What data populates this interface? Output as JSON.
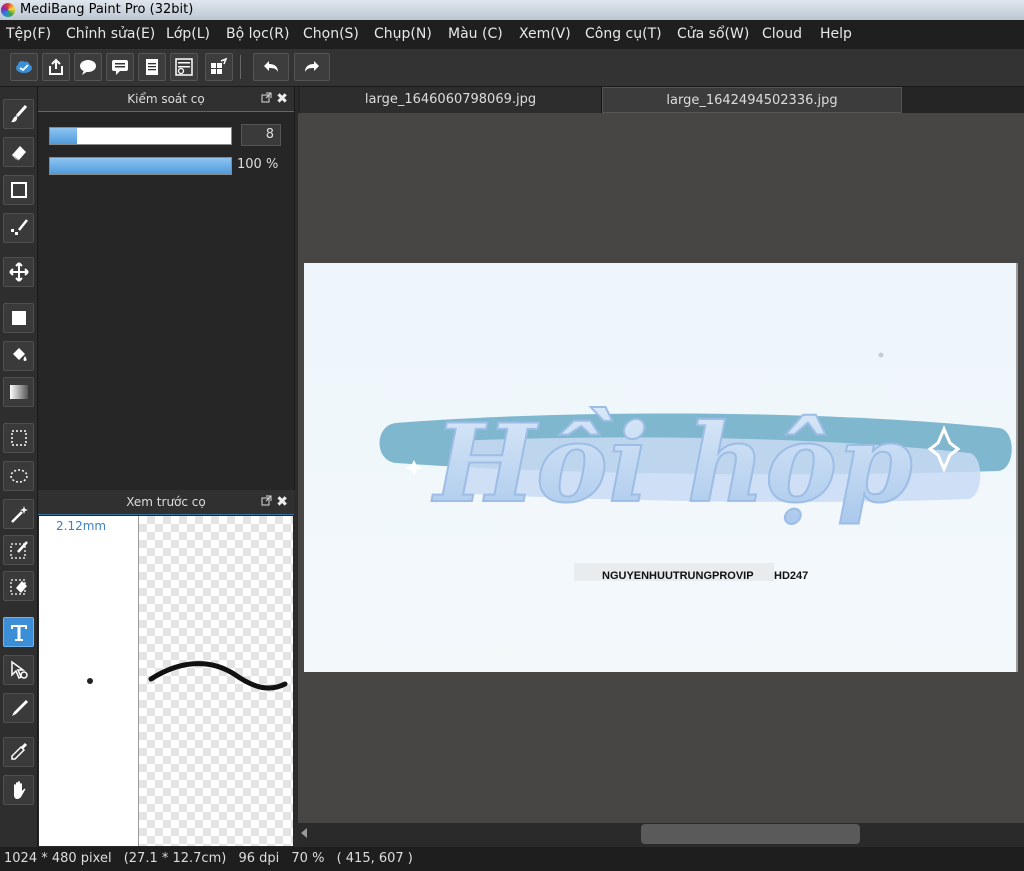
{
  "window": {
    "title": "MediBang Paint Pro (32bit)"
  },
  "menu": [
    "Tệp(F)",
    "Chỉnh sửa(E)",
    "Lớp(L)",
    "Bộ lọc(R)",
    "Chọn(S)",
    "Chụp(N)",
    "Màu (C)",
    "Xem(V)",
    "Công cụ(T)",
    "Cửa sổ(W)",
    "Cloud",
    "Help"
  ],
  "toolbar": {
    "icons": [
      "cloud-save-icon",
      "share-icon",
      "speech-bubble-icon",
      "comment-icon",
      "document-icon",
      "list-icon",
      "grid-icon",
      "undo-icon",
      "redo-icon"
    ]
  },
  "tools": [
    "brush-icon",
    "eraser-icon",
    "rectangle-icon",
    "dot-tool-icon",
    "move-icon",
    "fill-rect-icon",
    "bucket-icon",
    "gradient-icon",
    "select-rect-icon",
    "lasso-icon",
    "magic-wand-icon",
    "select-pen-icon",
    "select-eraser-icon",
    "text-icon",
    "operation-icon",
    "eyedropper-soft-icon",
    "eyedropper-icon",
    "hand-icon"
  ],
  "brush_panel": {
    "title": "Kiểm soát cọ",
    "size_value": "8",
    "size_fraction": 0.15,
    "opacity_label": "100 %",
    "opacity_fraction": 1.0
  },
  "preview_panel": {
    "title": "Xem trước cọ",
    "size_label": "2.12mm"
  },
  "tabs": [
    "large_1646060798069.jpg",
    "large_1642494502336.jpg"
  ],
  "active_tab": 1,
  "canvas": {
    "headline": "Hồi hộp",
    "credit_left": "NGUYENHUUTRUNGPROVIP",
    "credit_right": "HD247",
    "colors": {
      "band": "#7fb7cf",
      "lettering": "#bcd7f3",
      "background": "#eef6fb"
    }
  },
  "status": {
    "pixels": "1024 * 480 pixel",
    "cm": "(27.1 * 12.7cm)",
    "dpi": "96 dpi",
    "zoom": "70 %",
    "coords": "( 415, 607 )"
  }
}
